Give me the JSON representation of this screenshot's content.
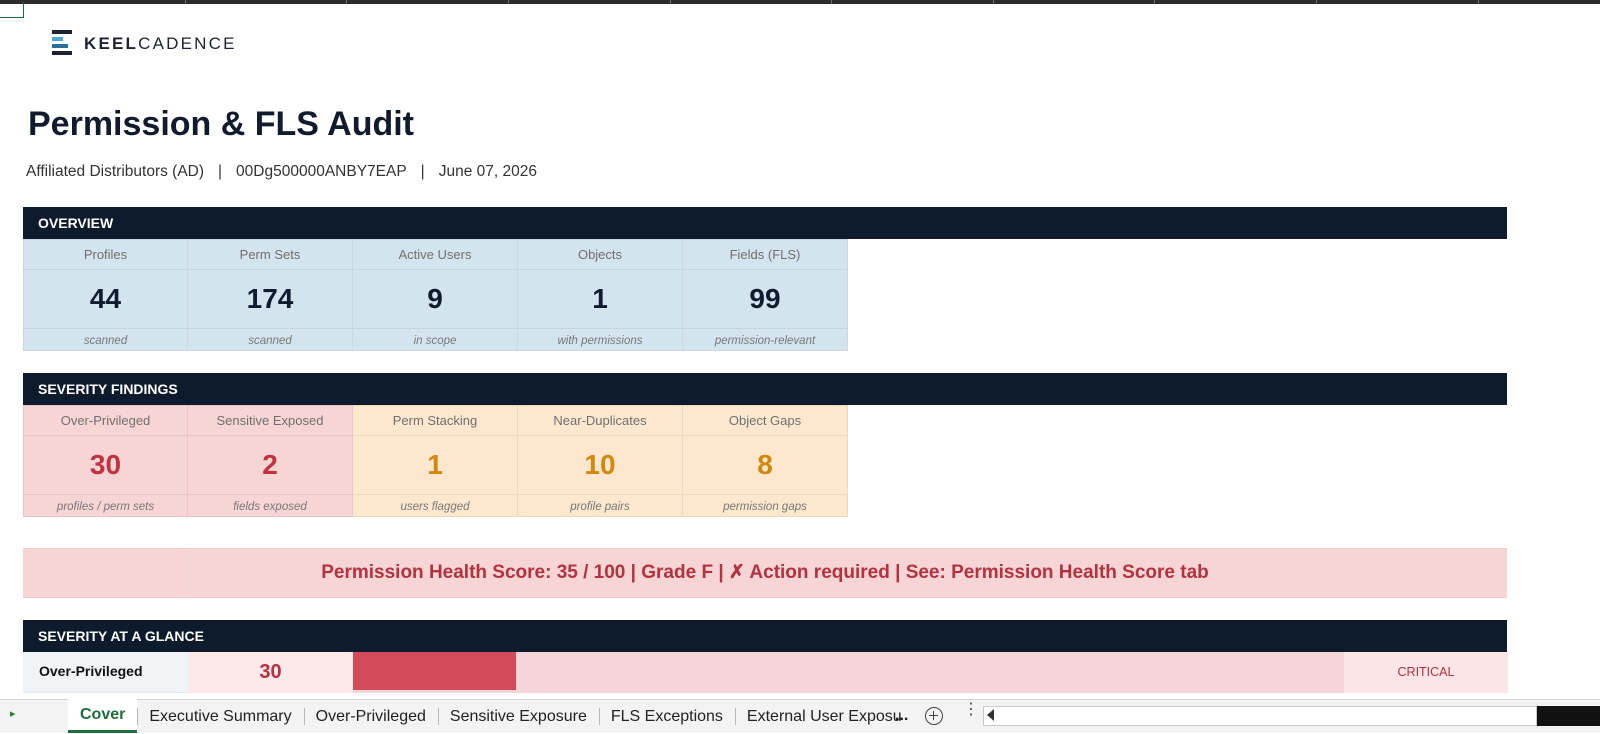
{
  "logo": {
    "bold": "KEEL",
    "light": "CADENCE"
  },
  "title": "Permission & FLS Audit",
  "subtitle": {
    "org": "Affiliated Distributors (AD)",
    "org_id": "00Dg500000ANBY7EAP",
    "date": "June 07, 2026",
    "separator": "|"
  },
  "overview": {
    "heading": "OVERVIEW",
    "cards": [
      {
        "label": "Profiles",
        "value": "44",
        "sub": "scanned"
      },
      {
        "label": "Perm Sets",
        "value": "174",
        "sub": "scanned"
      },
      {
        "label": "Active Users",
        "value": "9",
        "sub": "in scope"
      },
      {
        "label": "Objects",
        "value": "1",
        "sub": "with permissions"
      },
      {
        "label": "Fields (FLS)",
        "value": "99",
        "sub": "permission-relevant"
      }
    ]
  },
  "severity": {
    "heading": "SEVERITY FINDINGS",
    "cards": [
      {
        "label": "Over-Privileged",
        "value": "30",
        "sub": "profiles / perm sets"
      },
      {
        "label": "Sensitive Exposed",
        "value": "2",
        "sub": "fields exposed"
      },
      {
        "label": "Perm Stacking",
        "value": "1",
        "sub": "users flagged"
      },
      {
        "label": "Near-Duplicates",
        "value": "10",
        "sub": "profile pairs"
      },
      {
        "label": "Object Gaps",
        "value": "8",
        "sub": "permission gaps"
      }
    ]
  },
  "health": {
    "text": "Permission Health Score:   35 / 100   |   Grade F   |   ✗  Action required   |   See: Permission Health Score tab"
  },
  "glance": {
    "heading": "SEVERITY AT A GLANCE",
    "rows": [
      {
        "label": "Over-Privileged",
        "value": "30",
        "fill_fraction": 0.165,
        "tag": "CRITICAL"
      }
    ]
  },
  "tabs": [
    {
      "label": "Cover",
      "active": true
    },
    {
      "label": "Executive Summary",
      "active": false
    },
    {
      "label": "Over-Privileged",
      "active": false
    },
    {
      "label": "Sensitive Exposure",
      "active": false
    },
    {
      "label": "FLS Exceptions",
      "active": false
    },
    {
      "label": "External User Exposu",
      "active": false
    }
  ],
  "tab_overflow": "...",
  "colors": {
    "navy": "#0e1b2c",
    "blue_card": "#d3e4ee",
    "pink_card": "#f8d5d5",
    "amber_card": "#fde8cf",
    "critical_red": "#c0323e",
    "amber_text": "#d4870e",
    "excel_green": "#1e6e3c"
  }
}
